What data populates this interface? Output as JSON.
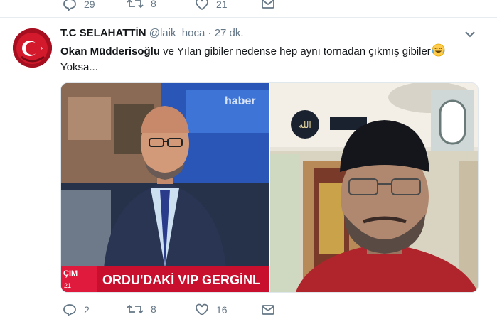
{
  "previous_tweet": {
    "reply_count": "29",
    "retweet_count": "8",
    "like_count": "21"
  },
  "tweet": {
    "display_name": "T.C SELAHATTİN",
    "handle": "@laik_hoca",
    "separator": "·",
    "time": "27 dk.",
    "text_mention": "Okan Müdderisoğlu",
    "text_rest": " ve Yılan gibiler nedense hep aynı tornadan çıkmış gibiler",
    "text_line2": "Yoksa...",
    "media": {
      "left_logo": "haber",
      "left_ticker": "ORDU'DAKİ VIP GERGİNL",
      "left_ticker_tag": "ÇIM",
      "left_clock": "21",
      "right_wall_text": "الله"
    },
    "actions": {
      "reply_count": "2",
      "retweet_count": "8",
      "like_count": "16"
    }
  },
  "colors": {
    "accent": "#1da1f2",
    "icon_gray": "#657786",
    "avatar_red": "#c8102e",
    "ticker_red": "#c8102e"
  },
  "icons": [
    "reply-icon",
    "retweet-icon",
    "like-icon",
    "message-icon",
    "caret-down-icon",
    "avatar-flag",
    "crying-laughing-emoji"
  ]
}
